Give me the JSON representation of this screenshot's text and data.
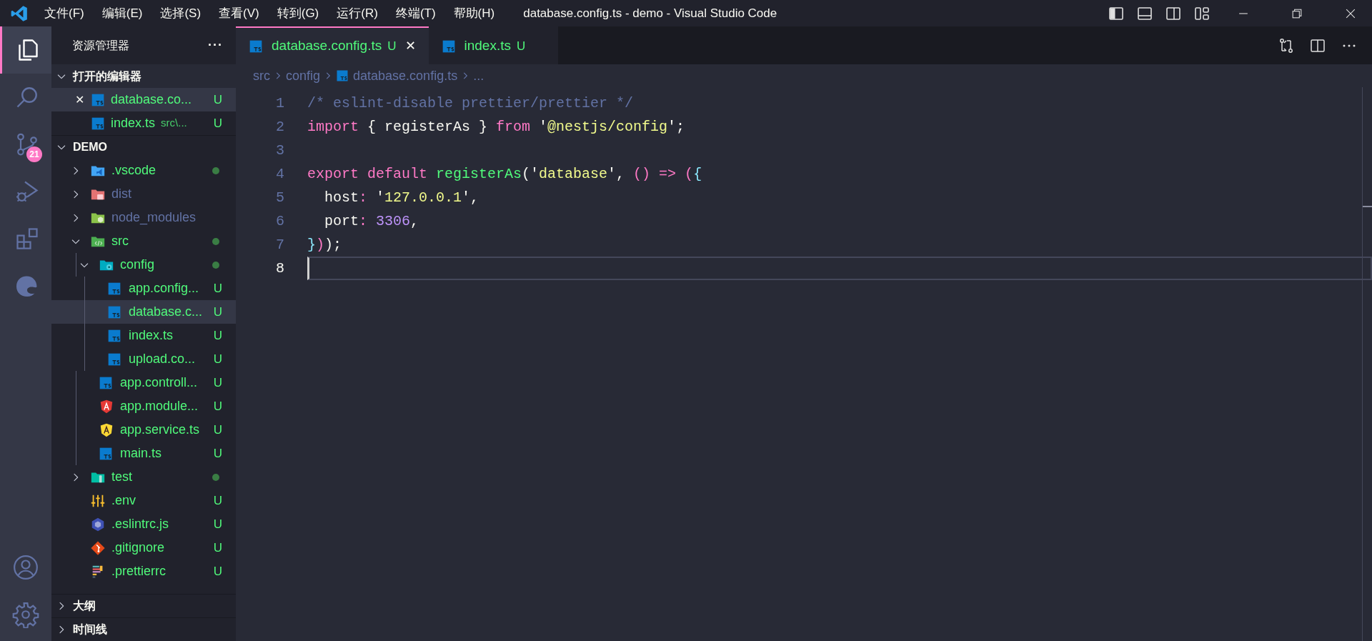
{
  "menu": [
    "文件(F)",
    "编辑(E)",
    "选择(S)",
    "查看(V)",
    "转到(G)",
    "运行(R)",
    "终端(T)",
    "帮助(H)"
  ],
  "window": {
    "title": "database.config.ts - demo - Visual Studio Code"
  },
  "activity_bar": {
    "items": [
      {
        "kind": "explorer",
        "selected": true
      },
      {
        "kind": "search",
        "selected": false
      },
      {
        "kind": "source-control",
        "selected": false,
        "badge": "21"
      },
      {
        "kind": "run",
        "selected": false
      },
      {
        "kind": "extensions",
        "selected": false
      },
      {
        "kind": "swirl",
        "selected": false
      }
    ]
  },
  "sidebar": {
    "title": "资源管理器",
    "more": "···",
    "open_editors": {
      "title": "打开的编辑器",
      "expanded": true,
      "items": [
        {
          "name": "database.co...",
          "status": "U",
          "selected": true,
          "close": "✕"
        },
        {
          "name": "index.ts",
          "hint": "src\\...",
          "status": "U",
          "selected": false
        }
      ]
    },
    "folder": {
      "title": "DEMO",
      "expanded": true,
      "items": [
        {
          "name": ".vscode",
          "kind": "vscode-folder",
          "expanded": false,
          "dot": true,
          "ignored": false,
          "selected": false
        },
        {
          "name": "dist",
          "kind": "dist-folder",
          "expanded": false,
          "dot": false,
          "ignored": true,
          "selected": false
        },
        {
          "name": "node_modules",
          "kind": "node-folder",
          "expanded": false,
          "dot": false,
          "ignored": true,
          "selected": false
        },
        {
          "name": "src",
          "kind": "src-folder",
          "expanded": true,
          "dot": true,
          "ignored": false,
          "selected": false,
          "children": [
            {
              "name": "config",
              "kind": "config-folder",
              "expanded": true,
              "dot": true,
              "ignored": false,
              "selected": false,
              "children": [
                {
                  "name": "app.config...",
                  "kind": "ts",
                  "status": "U",
                  "ignored": false,
                  "selected": false
                },
                {
                  "name": "database.c...",
                  "kind": "ts",
                  "status": "U",
                  "ignored": false,
                  "selected": true
                },
                {
                  "name": "index.ts",
                  "kind": "ts",
                  "status": "U",
                  "ignored": false,
                  "selected": false
                },
                {
                  "name": "upload.co...",
                  "kind": "ts",
                  "status": "U",
                  "ignored": false,
                  "selected": false
                }
              ]
            },
            {
              "name": "app.controll...",
              "kind": "ts",
              "status": "U",
              "ignored": false,
              "selected": false
            },
            {
              "name": "app.module...",
              "kind": "angular-red",
              "status": "U",
              "ignored": false,
              "selected": false
            },
            {
              "name": "app.service.ts",
              "kind": "angular-yellow",
              "status": "U",
              "ignored": false,
              "selected": false
            },
            {
              "name": "main.ts",
              "kind": "ts",
              "status": "U",
              "ignored": false,
              "selected": false
            }
          ]
        },
        {
          "name": "test",
          "kind": "test-folder",
          "expanded": false,
          "dot": true,
          "ignored": false,
          "selected": false
        },
        {
          "name": ".env",
          "kind": "env",
          "status": "U",
          "ignored": false,
          "selected": false
        },
        {
          "name": ".eslintrc.js",
          "kind": "eslint",
          "status": "U",
          "ignored": false,
          "selected": false
        },
        {
          "name": ".gitignore",
          "kind": "git",
          "status": "U",
          "ignored": false,
          "selected": false
        },
        {
          "name": ".prettierrc",
          "kind": "prettier",
          "status": "U",
          "ignored": false,
          "selected": false
        }
      ]
    },
    "bottom_sections": [
      {
        "title": "大纲",
        "expanded": false
      },
      {
        "title": "时间线",
        "expanded": false
      }
    ]
  },
  "tabs": [
    {
      "label": "database.config.ts",
      "status": "U",
      "selected": true,
      "close": "✕"
    },
    {
      "label": "index.ts",
      "status": "U",
      "selected": false
    }
  ],
  "breadcrumb": [
    {
      "label": "src",
      "kind": "text"
    },
    {
      "label": "config",
      "kind": "text"
    },
    {
      "label": "database.config.ts",
      "kind": "ts"
    },
    {
      "label": "...",
      "kind": "text"
    }
  ],
  "editor": {
    "lines": [
      {
        "number": "1",
        "current": false,
        "tokens": [
          {
            "t": "/* eslint-disable prettier/prettier */",
            "kind": "comment"
          }
        ]
      },
      {
        "number": "2",
        "current": false,
        "tokens": [
          {
            "t": "import",
            "kind": "keyword"
          },
          {
            "t": " { registerAs } ",
            "kind": "plain"
          },
          {
            "t": "from",
            "kind": "keyword"
          },
          {
            "t": " '",
            "kind": "plain"
          },
          {
            "t": "@nestjs/config",
            "kind": "string"
          },
          {
            "t": "';",
            "kind": "plain"
          }
        ]
      },
      {
        "number": "3",
        "current": false
      },
      {
        "number": "4",
        "current": false,
        "tokens": [
          {
            "t": "export default",
            "kind": "keyword"
          },
          {
            "t": " registerAs",
            "kind": "function"
          },
          {
            "t": "('",
            "kind": "plain"
          },
          {
            "t": "database",
            "kind": "string"
          },
          {
            "t": "', ",
            "kind": "plain"
          },
          {
            "t": "() => (",
            "kind": "keyword"
          },
          {
            "t": "{",
            "kind": "bracket"
          }
        ]
      },
      {
        "number": "5",
        "current": false,
        "tokens": [
          {
            "t": "  host",
            "kind": "plain"
          },
          {
            "t": ":",
            "kind": "keyword"
          },
          {
            "t": " '",
            "kind": "plain"
          },
          {
            "t": "127.0.0.1",
            "kind": "string"
          },
          {
            "t": "',",
            "kind": "plain"
          }
        ]
      },
      {
        "number": "6",
        "current": false,
        "tokens": [
          {
            "t": "  port",
            "kind": "plain"
          },
          {
            "t": ":",
            "kind": "keyword"
          },
          {
            "t": " 3306",
            "kind": "number"
          },
          {
            "t": ",",
            "kind": "plain"
          }
        ]
      },
      {
        "number": "7",
        "current": false,
        "tokens": [
          {
            "t": "}",
            "kind": "bracket"
          },
          {
            "t": ")",
            "kind": "keyword"
          },
          {
            "t": ");",
            "kind": "plain"
          }
        ]
      },
      {
        "number": "8",
        "current": true
      }
    ]
  }
}
